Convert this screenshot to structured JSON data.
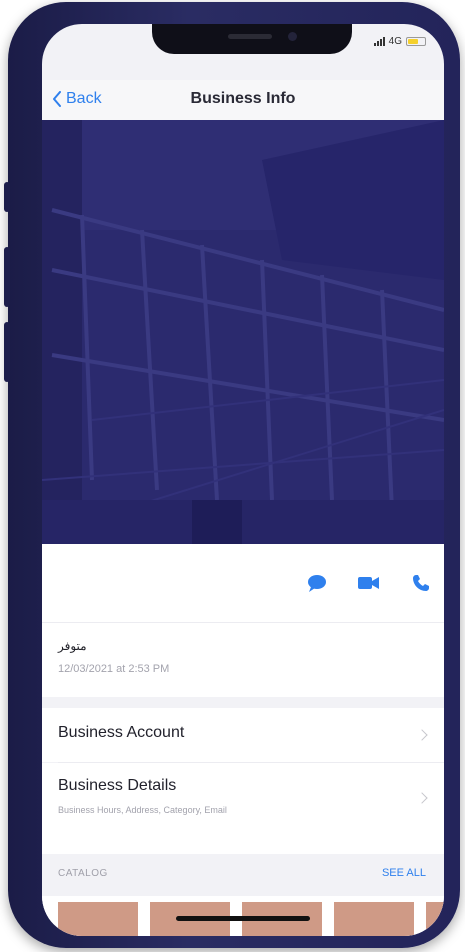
{
  "status_bar": {
    "network": "4G",
    "battery_level": 0.6
  },
  "nav": {
    "back_label": "Back",
    "title": "Business Info"
  },
  "actions": [
    {
      "name": "message",
      "icon": "message-bubble-icon"
    },
    {
      "name": "video",
      "icon": "video-camera-icon"
    },
    {
      "name": "call",
      "icon": "phone-icon"
    }
  ],
  "status": {
    "text": "متوفر",
    "date": "12/03/2021 at 2:53 PM"
  },
  "rows": {
    "business_account": {
      "title": "Business Account"
    },
    "business_details": {
      "title": "Business Details",
      "subtitle": "Business Hours, Address, Category, Email"
    }
  },
  "catalog": {
    "label": "CATALOG",
    "see_all": "SEE ALL"
  },
  "colors": {
    "accent": "#2f80ed",
    "hero_overlay": "#2b2a6e",
    "thumb": "#cf9a86"
  }
}
